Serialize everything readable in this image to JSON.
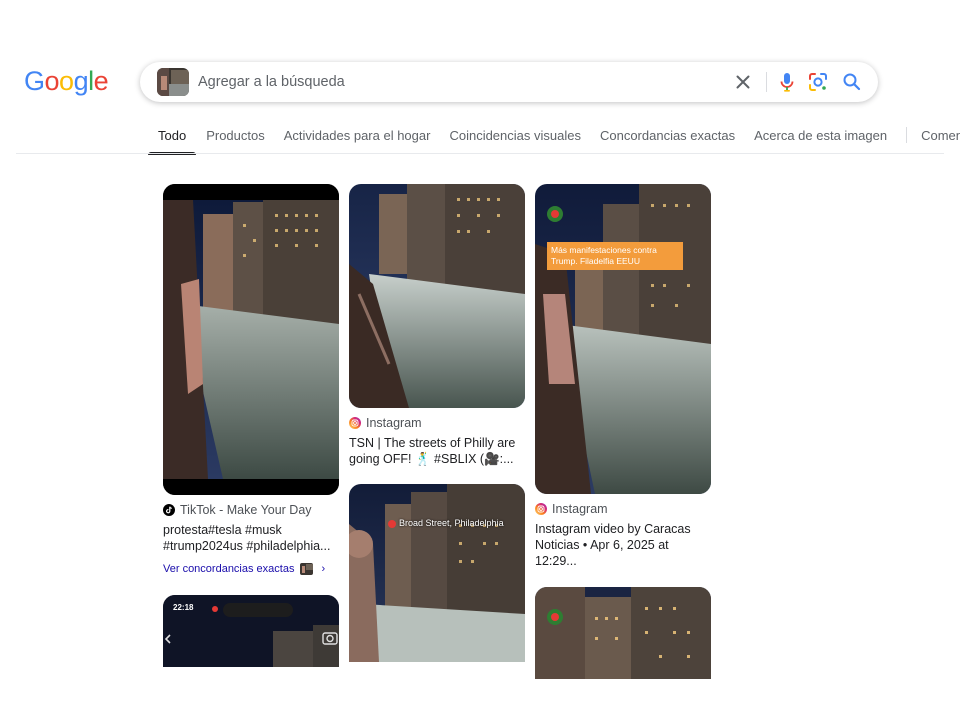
{
  "logo": {
    "letters": [
      "G",
      "o",
      "o",
      "g",
      "l",
      "e"
    ],
    "colors": [
      "#4285F4",
      "#EA4335",
      "#FBBC05",
      "#4285F4",
      "#34A853",
      "#EA4335"
    ]
  },
  "search": {
    "placeholder": "Agregar a la búsqueda",
    "value": "",
    "icons": {
      "clear": "close-icon",
      "voice": "microphone-icon",
      "lens": "google-lens-icon",
      "search": "magnifier-icon"
    }
  },
  "tabs": [
    {
      "label": "Todo",
      "active": true
    },
    {
      "label": "Productos"
    },
    {
      "label": "Actividades para el hogar"
    },
    {
      "label": "Coincidencias visuales"
    },
    {
      "label": "Concordancias exactas"
    },
    {
      "label": "Acerca de esta imagen"
    },
    {
      "label": "Comentarios"
    }
  ],
  "results": [
    {
      "source": "TikTok - Make Your Day",
      "source_icon": "tiktok-icon",
      "title": "protesta#tesla #musk #trump2024us #philadelphia...",
      "exact_matches_label": "Ver concordancias exactas",
      "chevron": "›"
    },
    {
      "source": "Instagram",
      "source_icon": "instagram-icon",
      "title": "TSN | The streets of Philly are going OFF! 🕺 #SBLIX (🎥:..."
    },
    {
      "source": "Instagram",
      "source_icon": "instagram-icon",
      "title": "Instagram video by Caracas Noticias • Apr 6, 2025 at 12:29...",
      "image_caption": "Más manifestaciones contra Trump. Filadelfia EEUU"
    },
    {
      "image_caption": "Broad Street, Philadelphia"
    },
    {
      "status_time": "22:18"
    }
  ],
  "colors": {
    "accent_link": "#1a0dab",
    "caption_orange": "#f39c3c"
  }
}
